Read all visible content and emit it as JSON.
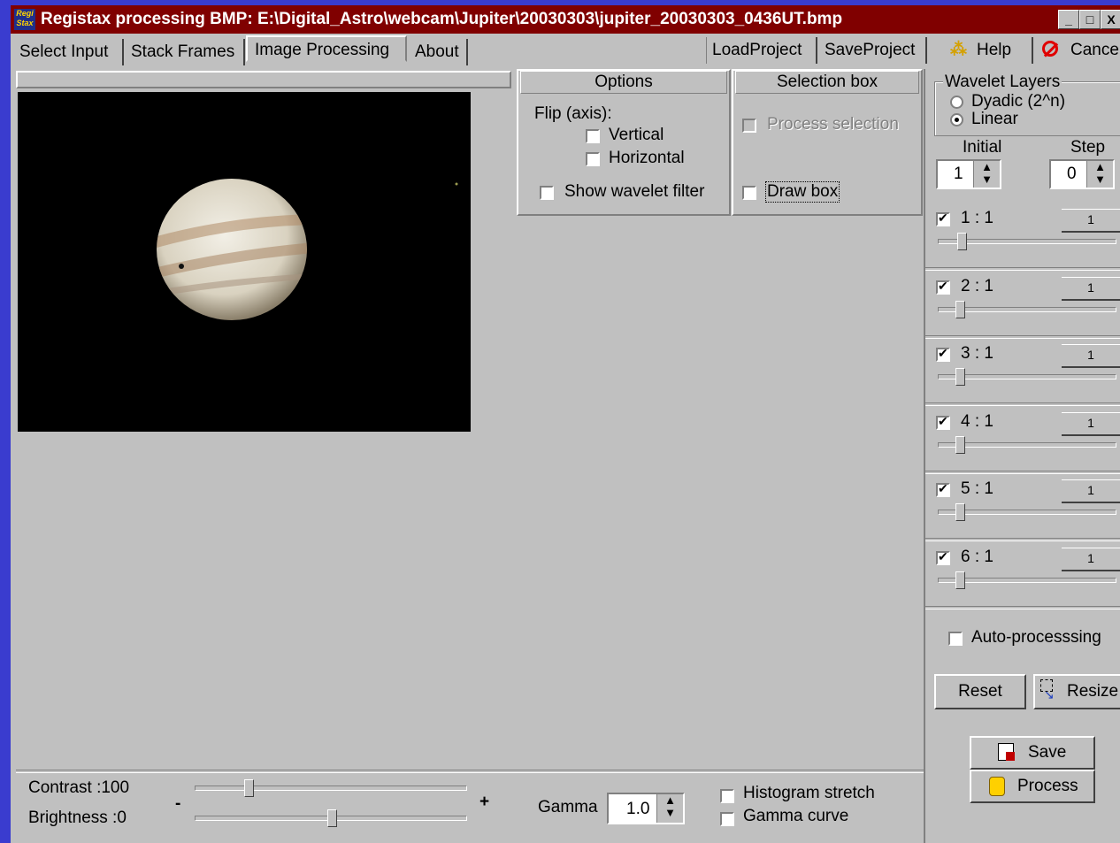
{
  "titlebar": {
    "title": "Registax processing BMP: E:\\Digital_Astro\\webcam\\Jupiter\\20030303\\jupiter_20030303_0436UT.bmp",
    "app_icon_text": "Regi Stax",
    "minimize": "_",
    "maximize": "□",
    "close": "X"
  },
  "tabs": [
    "Select Input",
    "Stack Frames",
    "Image Processing",
    "About"
  ],
  "active_tab": "Image Processing",
  "toolbar": {
    "load_project": "LoadProject",
    "save_project": "SaveProject",
    "help": "Help",
    "cancel": "Cancel"
  },
  "options": {
    "header": "Options",
    "flip_label": "Flip (axis):",
    "vertical": "Vertical",
    "horizontal": "Horizontal",
    "show_wavelet_filter": "Show wavelet filter"
  },
  "selection_box": {
    "header": "Selection box",
    "process_selection": "Process selection",
    "draw_box": "Draw box"
  },
  "wavelet": {
    "header": "Wavelet Layers",
    "dyadic": "Dyadic (2^n)",
    "linear": "Linear",
    "selected_mode": "Linear",
    "initial_label": "Initial",
    "initial_value": "1",
    "step_label": "Step",
    "step_value": "0",
    "layers": [
      {
        "label": "1 : 1",
        "value": "1",
        "checked": true
      },
      {
        "label": "2 : 1",
        "value": "1",
        "checked": true
      },
      {
        "label": "3 : 1",
        "value": "1",
        "checked": true
      },
      {
        "label": "4 : 1",
        "value": "1",
        "checked": true
      },
      {
        "label": "5 : 1",
        "value": "1",
        "checked": true
      },
      {
        "label": "6 : 1",
        "value": "1",
        "checked": true
      }
    ],
    "auto_processing": "Auto-processsing",
    "reset": "Reset",
    "resize": "Resize",
    "save": "Save",
    "process": "Process"
  },
  "adjust": {
    "contrast_label": "Contrast :100",
    "brightness_label": "Brightness :0",
    "minus": "-",
    "plus": "+",
    "gamma_label": "Gamma",
    "gamma_value": "1.0",
    "histogram_stretch": "Histogram stretch",
    "gamma_curve": "Gamma curve"
  },
  "colors": {
    "title_bg": "#800000",
    "desktop": "#3a3ccf",
    "face": "#c0c0c0",
    "image_bg": "#000000"
  }
}
